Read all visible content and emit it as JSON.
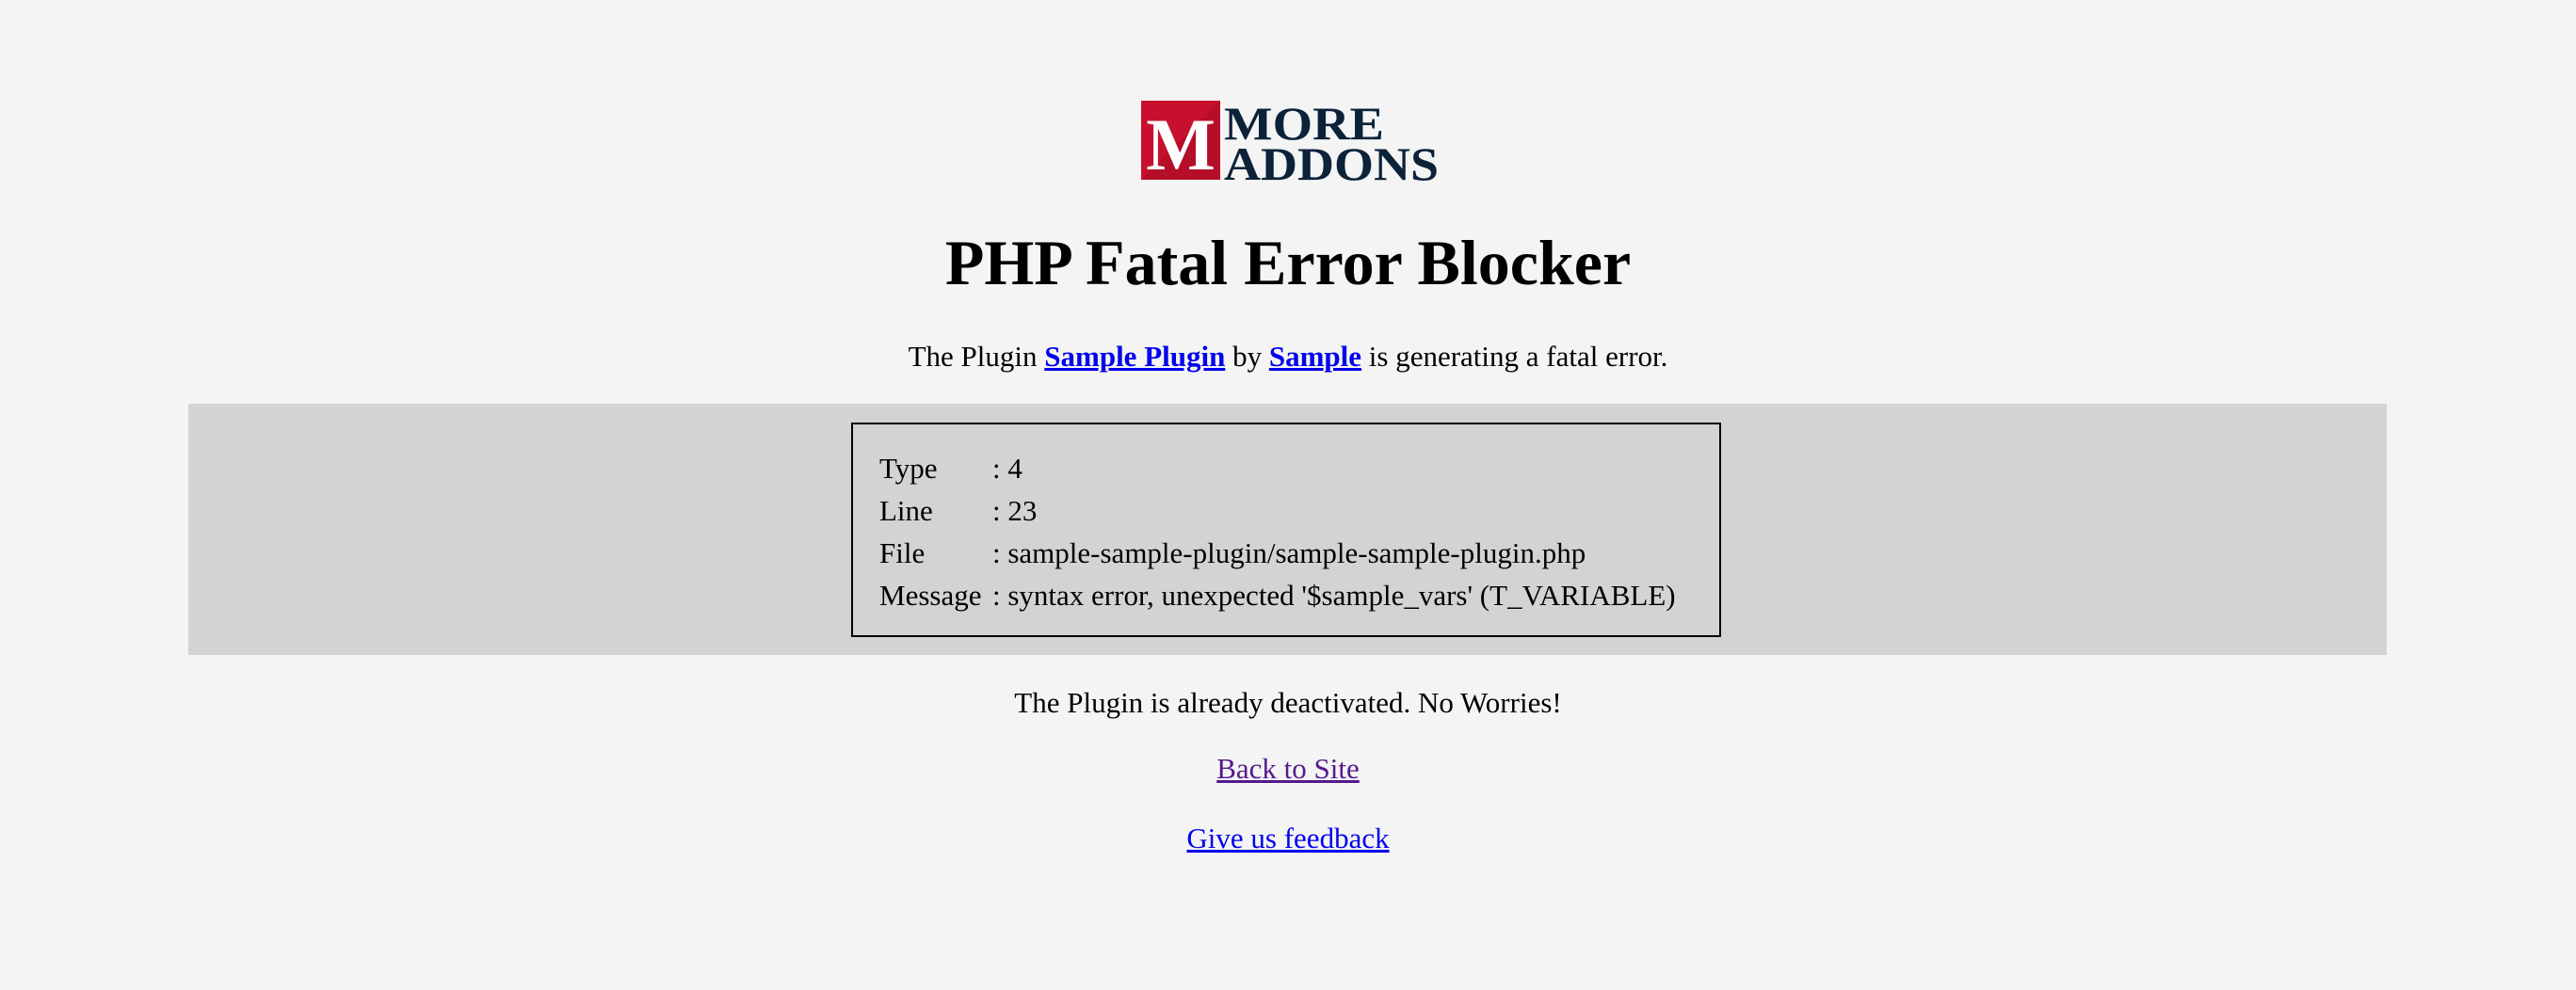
{
  "logo": {
    "icon": "more-addons-m-logo",
    "line1": "MORE",
    "line2": "ADDONS",
    "brand_red": "#c8102e",
    "brand_navy": "#0b2239"
  },
  "page": {
    "title": "PHP Fatal Error Blocker"
  },
  "intro": {
    "prefix": "The Plugin ",
    "plugin_link": "Sample Plugin",
    "by_text": " by ",
    "author_link": "Sample",
    "suffix": " is generating a fatal error."
  },
  "error_details": {
    "rows": [
      {
        "label": "Type",
        "value": ": 4"
      },
      {
        "label": "Line",
        "value": ": 23"
      },
      {
        "label": "File",
        "value": ": sample-sample-plugin/sample-sample-plugin.php"
      },
      {
        "label": "Message",
        "value": ": syntax error, unexpected '$sample_vars' (T_VARIABLE)"
      }
    ]
  },
  "status": {
    "message": "The Plugin is already deactivated. No Worries!"
  },
  "links": {
    "back_to_site": "Back to Site",
    "feedback": "Give us feedback"
  }
}
